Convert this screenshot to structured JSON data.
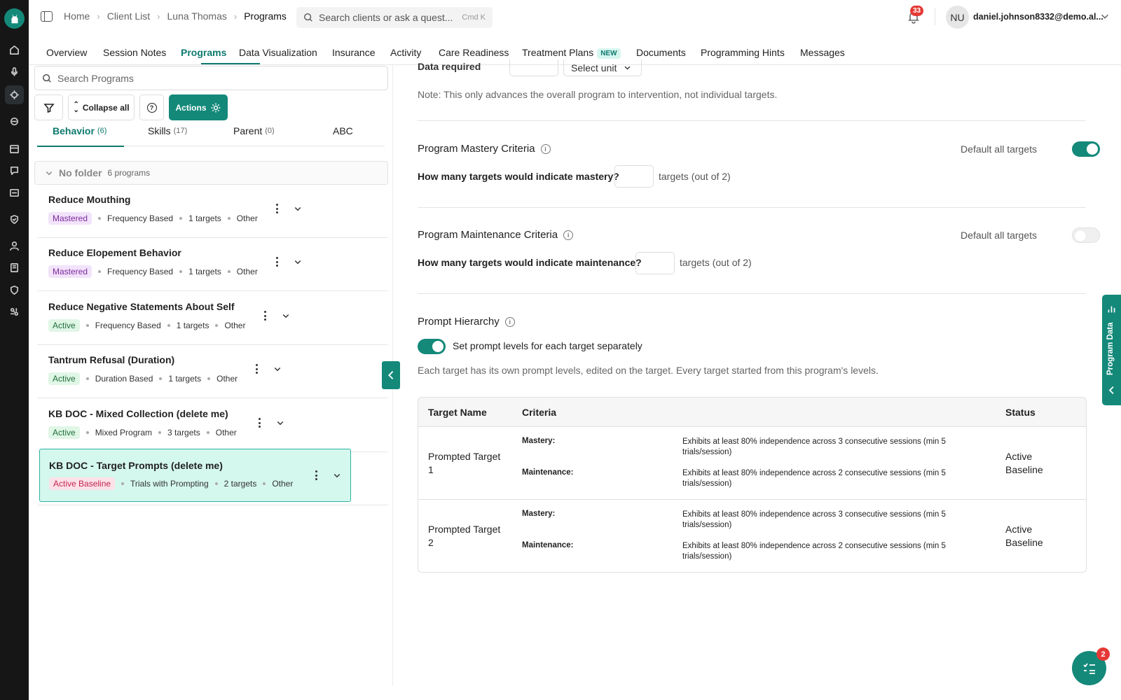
{
  "breadcrumbs": [
    "Home",
    "Client List",
    "Luna Thomas",
    "Programs"
  ],
  "global_search": {
    "placeholder": "Search clients or ask a quest...",
    "shortcut": "Cmd K"
  },
  "notifications": {
    "count": "33"
  },
  "user": {
    "initials": "NU",
    "email": "daniel.johnson8332@demo.al..."
  },
  "tabs": [
    {
      "label": "Overview"
    },
    {
      "label": "Session Notes"
    },
    {
      "label": "Programs"
    },
    {
      "label": "Data Visualization"
    },
    {
      "label": "Insurance"
    },
    {
      "label": "Activity"
    },
    {
      "label": "Care Readiness"
    },
    {
      "label": "Treatment Plans",
      "badge": "NEW"
    },
    {
      "label": "Documents"
    },
    {
      "label": "Programming Hints"
    },
    {
      "label": "Messages"
    }
  ],
  "left": {
    "search_placeholder": "Search Programs",
    "collapse_label": "Collapse all",
    "actions_label": "Actions",
    "program_tabs": [
      {
        "label": "Behavior",
        "count": "(6)"
      },
      {
        "label": "Skills",
        "count": "(17)"
      },
      {
        "label": "Parent",
        "count": "(0)"
      },
      {
        "label": "ABC",
        "count": ""
      }
    ],
    "folder": {
      "name": "No folder",
      "count": "6 programs"
    },
    "programs": [
      {
        "name": "Reduce Mouthing",
        "status": "Mastered",
        "type": "Frequency Based",
        "targets": "1 targets",
        "category": "Other"
      },
      {
        "name": "Reduce Elopement Behavior",
        "status": "Mastered",
        "type": "Frequency Based",
        "targets": "1 targets",
        "category": "Other"
      },
      {
        "name": "Reduce Negative Statements About Self",
        "status": "Active",
        "type": "Frequency Based",
        "targets": "1 targets",
        "category": "Other"
      },
      {
        "name": "Tantrum Refusal (Duration)",
        "status": "Active",
        "type": "Duration Based",
        "targets": "1 targets",
        "category": "Other"
      },
      {
        "name": "KB DOC - Mixed Collection (delete me)",
        "status": "Active",
        "type": "Mixed Program",
        "targets": "3 targets",
        "category": "Other"
      },
      {
        "name": "KB DOC - Target Prompts (delete me)",
        "status": "Active Baseline",
        "type": "Trials with Prompting",
        "targets": "2 targets",
        "category": "Other"
      }
    ]
  },
  "right": {
    "data_required_label": "Data required",
    "select_unit": "Select unit",
    "note": "Note: This only advances the overall program to intervention, not individual targets.",
    "mastery": {
      "title": "Program Mastery Criteria",
      "default_label": "Default all targets",
      "default_on": true,
      "question": "How many targets would indicate mastery?",
      "tail": "targets (out of 2)"
    },
    "maintenance": {
      "title": "Program Maintenance Criteria",
      "default_label": "Default all targets",
      "default_on": false,
      "question": "How many targets would indicate maintenance?",
      "tail": "targets (out of 2)"
    },
    "prompt": {
      "title": "Prompt Hierarchy",
      "toggle_label": "Set prompt levels for each target separately",
      "toggle_on": true,
      "description": "Each target has its own prompt levels, edited on the target. Every target started from this program's levels."
    },
    "table": {
      "headers": [
        "Target Name",
        "Criteria",
        "Status"
      ],
      "rows": [
        {
          "name": "Prompted Target 1",
          "mastery_label": "Mastery:",
          "mastery_text": "Exhibits at least 80% independence across 3 consecutive sessions (min 5 trials/session)",
          "maintenance_label": "Maintenance:",
          "maintenance_text": "Exhibits at least 80% independence across 2 consecutive sessions (min 5 trials/session)",
          "status": "Active Baseline"
        },
        {
          "name": "Prompted Target 2",
          "mastery_label": "Mastery:",
          "mastery_text": "Exhibits at least 80% independence across 3 consecutive sessions (min 5 trials/session)",
          "maintenance_label": "Maintenance:",
          "maintenance_text": "Exhibits at least 80% independence across 2 consecutive sessions (min 5 trials/session)",
          "status": "Active Baseline"
        }
      ]
    }
  },
  "program_data_tab": "Program Data",
  "fab_badge": "2",
  "colors": {
    "accent": "#14897a",
    "selected_bg": "#d4f7ee",
    "badge_red": "#e53935"
  }
}
